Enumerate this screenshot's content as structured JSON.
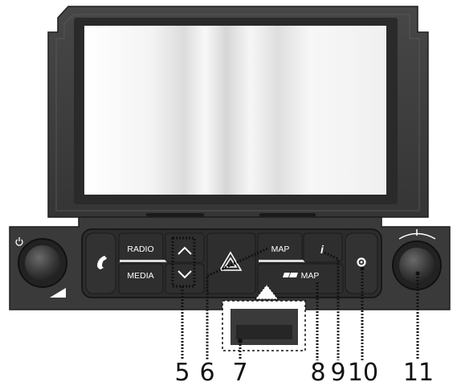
{
  "buttons": {
    "radio_label": "RADIO",
    "media_label": "MEDIA",
    "map_label": "MAP",
    "sd_map_label": "MAP"
  },
  "callouts": {
    "n5": "5",
    "n6": "6",
    "n7": "7",
    "n8": "8",
    "n9": "9",
    "n10": "10",
    "n11": "11"
  },
  "icons": {
    "power": "power-icon",
    "phone": "phone-icon",
    "up": "chevron-up-icon",
    "down": "chevron-down-icon",
    "hazard": "hazard-icon",
    "info": "info-icon",
    "settings": "gear-icon",
    "sd": "sd-card-icon"
  },
  "colors": {
    "bezel": "#3d3d3d",
    "panel": "#2f2f2f",
    "screen": "#f4f4f4",
    "label": "#ffffff"
  }
}
